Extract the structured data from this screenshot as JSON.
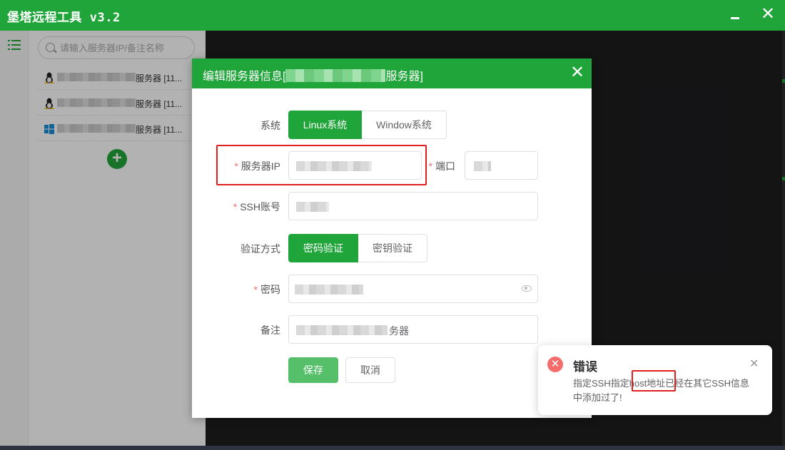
{
  "window": {
    "title": "堡塔远程工具 v3.2",
    "minimize_icon": "minimize-icon",
    "close_icon": "close-icon"
  },
  "sidebar": {
    "search_placeholder": "请输入服务器IP/备注名称",
    "servers": [
      {
        "os": "linux",
        "label": "服务器 [11..."
      },
      {
        "os": "linux",
        "label": "服务器 [11..."
      },
      {
        "os": "windows",
        "label": "服务器 [11..."
      }
    ],
    "add_icon": "plus-circle-icon"
  },
  "dialog": {
    "title_prefix": "编辑服务器信息[",
    "title_suffix": "服务器]",
    "labels": {
      "system": "系统",
      "server_ip": "服务器IP",
      "port": "端口",
      "ssh_account": "SSH账号",
      "auth_method": "验证方式",
      "password": "密码",
      "remark": "备注"
    },
    "required_mark": "*",
    "system_options": [
      "Linux系统",
      "Window系统"
    ],
    "system_selected": "Linux系统",
    "auth_options": [
      "密码验证",
      "密钥验证"
    ],
    "auth_selected": "密码验证",
    "remark_suffix": "务器",
    "save_label": "保存",
    "cancel_label": "取消"
  },
  "notification": {
    "type": "error",
    "title": "错误",
    "message": "指定SSH指定host地址已经在其它SSH信息中添加过了!",
    "error_color": "#f56c6c"
  },
  "colors": {
    "brand": "#20a53a",
    "highlight": "#e02020"
  }
}
